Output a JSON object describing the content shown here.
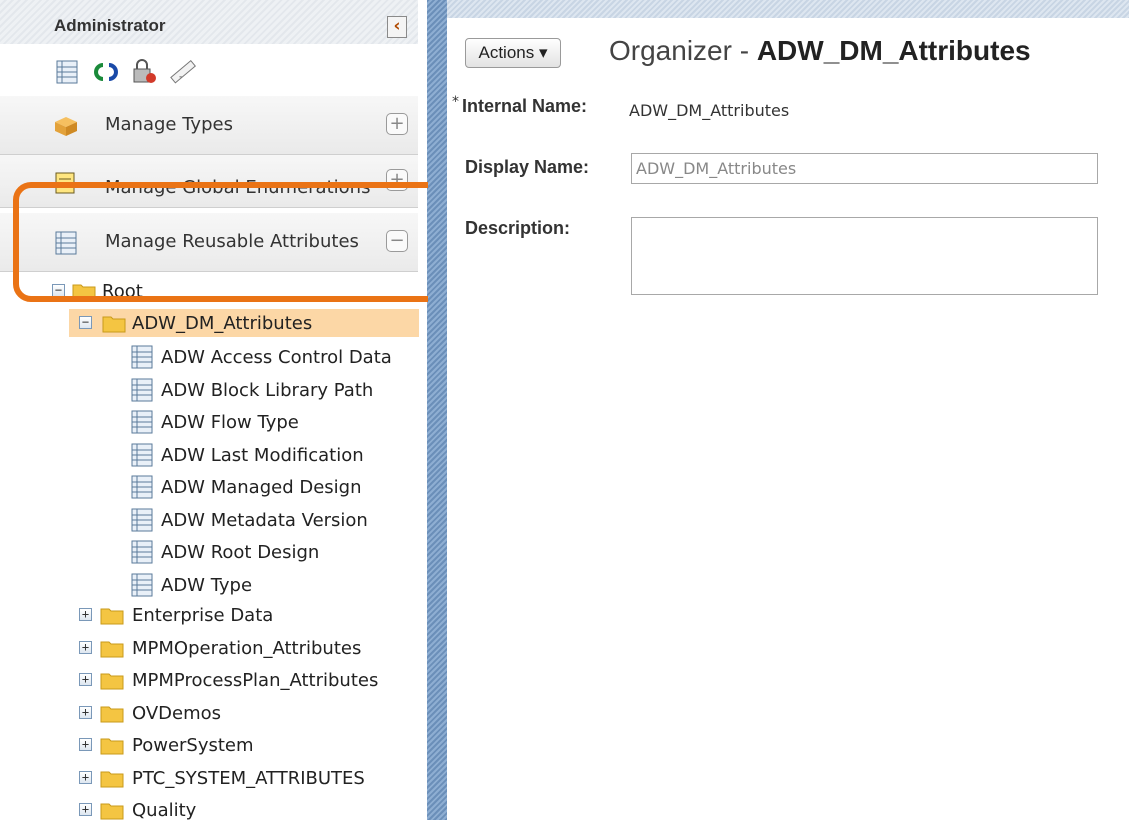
{
  "left_panel": {
    "title": "Administrator",
    "collapse_icon": "chevron-left-icon",
    "toolbar_icons": [
      "attribute-list-icon",
      "refresh-icon",
      "lock-settings-icon",
      "ruler-icon"
    ],
    "sections": [
      {
        "label": "Manage Types",
        "icon": "box-icon",
        "toggle": "+"
      },
      {
        "label": "Manage Global Enumerations",
        "icon": "enumeration-icon",
        "toggle": "+"
      },
      {
        "label": "Manage Reusable Attributes",
        "icon": "attribute-list-icon",
        "toggle": "−"
      }
    ],
    "tree": {
      "root": {
        "label": "Root",
        "toggle": "−"
      },
      "selected": {
        "label": "ADW_DM_Attributes",
        "toggle": "−"
      },
      "attributes": [
        "ADW Access Control Data",
        "ADW Block Library Path",
        "ADW Flow Type",
        "ADW Last Modification",
        "ADW Managed Design",
        "ADW Metadata Version",
        "ADW Root Design",
        "ADW Type"
      ],
      "folders": [
        {
          "label": "Enterprise Data",
          "toggle": "+"
        },
        {
          "label": "MPMOperation_Attributes",
          "toggle": "+"
        },
        {
          "label": "MPMProcessPlan_Attributes",
          "toggle": "+"
        },
        {
          "label": "OVDemos",
          "toggle": "+"
        },
        {
          "label": "PowerSystem",
          "toggle": "+"
        },
        {
          "label": "PTC_SYSTEM_ATTRIBUTES",
          "toggle": "+"
        },
        {
          "label": "Quality",
          "toggle": "+"
        }
      ]
    }
  },
  "right_panel": {
    "actions_label": "Actions ▾",
    "title_prefix": "Organizer - ",
    "title_name": "ADW_DM_Attributes",
    "form": {
      "required_mark": "*",
      "internal_name_label": "Internal Name:",
      "internal_name_value": "ADW_DM_Attributes",
      "display_name_label": "Display Name:",
      "display_name_value": "ADW_DM_Attributes",
      "description_label": "Description:",
      "description_value": ""
    }
  },
  "colors": {
    "highlight": "#ea7315",
    "selected_row": "#fcd7a6",
    "divider": "#6b8fb9"
  }
}
